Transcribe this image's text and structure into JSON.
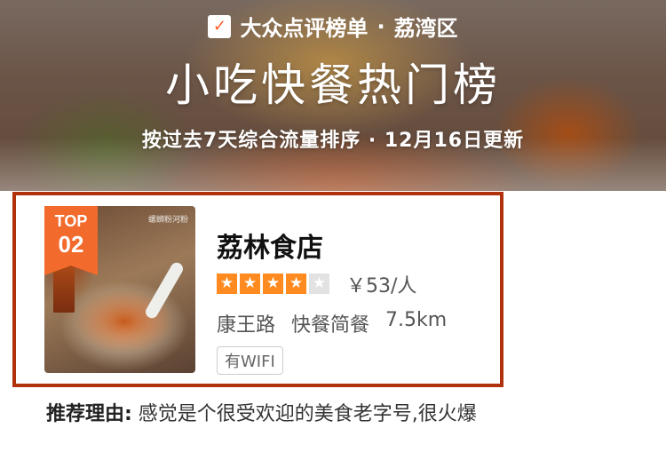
{
  "banner": {
    "brand_icon": "check-tag-icon",
    "brand": "大众点评榜单",
    "separator": "·",
    "district": "荔湾区",
    "title": "小吃快餐热门榜",
    "subtitle": "按过去7天综合流量排序 · 12月16日更新"
  },
  "card": {
    "rank_top": "TOP",
    "rank_number": "02",
    "thumbnail_watermark": "螺蛳粉河粉",
    "name": "荔林食店",
    "rating_stars": 4,
    "rating_max": 5,
    "price": "￥53/人",
    "street": "康王路",
    "category": "快餐简餐",
    "distance": "7.5km",
    "tag": "有WIFI",
    "highlight_border_color": "#b0320c",
    "badge_color": "#f26a2c",
    "star_color": "#ff8a1f"
  },
  "reason": {
    "label": "推荐理由:",
    "text": " 感觉是个很受欢迎的美食老字号,很火爆"
  }
}
